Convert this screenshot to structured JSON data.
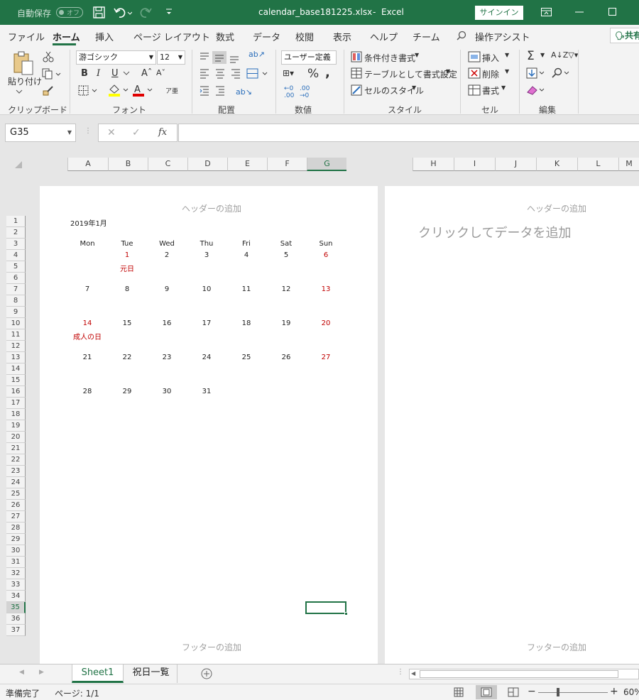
{
  "titlebar": {
    "autosave_label": "自動保存",
    "autosave_state": "オフ",
    "filename": "calendar_base181225.xlsx",
    "separator": "-",
    "app": "Excel",
    "signin": "サインイン"
  },
  "menu": {
    "items": [
      "ファイル",
      "ホーム",
      "挿入",
      "ページ レイアウト",
      "数式",
      "データ",
      "校閲",
      "表示",
      "ヘルプ",
      "チーム",
      "操作アシスト"
    ],
    "share": "共有"
  },
  "ribbon": {
    "clipboard": {
      "paste": "貼り付け",
      "group": "クリップボード"
    },
    "font": {
      "font_name": "游ゴシック",
      "font_size": "12",
      "bold": "B",
      "italic": "I",
      "underline": "U",
      "group": "フォント"
    },
    "alignment": {
      "group": "配置"
    },
    "number": {
      "format": "ユーザー定義",
      "percent": "%",
      "group": "数値"
    },
    "styles": {
      "conditional": "条件付き書式",
      "table": "テーブルとして書式設定",
      "cell": "セルのスタイル",
      "group": "スタイル"
    },
    "cells": {
      "insert": "挿入",
      "delete": "削除",
      "format": "書式",
      "group": "セル"
    },
    "editing": {
      "group": "編集"
    }
  },
  "formula_bar": {
    "name_box": "G35",
    "fx": "fx",
    "value": ""
  },
  "columns_left": [
    "A",
    "B",
    "C",
    "D",
    "E",
    "F",
    "G"
  ],
  "columns_right": [
    "H",
    "I",
    "J",
    "K",
    "L",
    "M"
  ],
  "rows": [
    "1",
    "2",
    "3",
    "4",
    "5",
    "6",
    "7",
    "8",
    "9",
    "10",
    "11",
    "12",
    "13",
    "14",
    "15",
    "16",
    "17",
    "18",
    "19",
    "20",
    "21",
    "22",
    "23",
    "24",
    "25",
    "26",
    "27",
    "28",
    "29",
    "30",
    "31",
    "32",
    "33",
    "34",
    "35",
    "36",
    "37"
  ],
  "selected_row": "35",
  "page1": {
    "header": "ヘッダーの追加",
    "footer": "フッターの追加"
  },
  "page2": {
    "header": "ヘッダーの追加",
    "footer": "フッターの追加",
    "placeholder": "クリックしてデータを追加"
  },
  "calendar": {
    "title": "2019年1月",
    "weekdays": [
      "Mon",
      "Tue",
      "Wed",
      "Thu",
      "Fri",
      "Sat",
      "Sun"
    ],
    "weeks": [
      [
        "",
        "1",
        "2",
        "3",
        "4",
        "5",
        "6"
      ],
      [
        "7",
        "8",
        "9",
        "10",
        "11",
        "12",
        "13"
      ],
      [
        "14",
        "15",
        "16",
        "17",
        "18",
        "19",
        "20"
      ],
      [
        "21",
        "22",
        "23",
        "24",
        "25",
        "26",
        "27"
      ],
      [
        "28",
        "29",
        "30",
        "31",
        "",
        "",
        ""
      ]
    ],
    "holidays": [
      {
        "week": 0,
        "day": 1,
        "name": "元日"
      },
      {
        "week": 2,
        "day": 0,
        "name": "成人の日"
      }
    ],
    "holiday_color": "#c00000"
  },
  "sheets": {
    "tabs": [
      "Sheet1",
      "祝日一覧"
    ],
    "active": "Sheet1"
  },
  "status": {
    "ready": "準備完了",
    "page": "ページ: 1/1",
    "zoom": "60%"
  },
  "colors": {
    "accent": "#217346"
  }
}
